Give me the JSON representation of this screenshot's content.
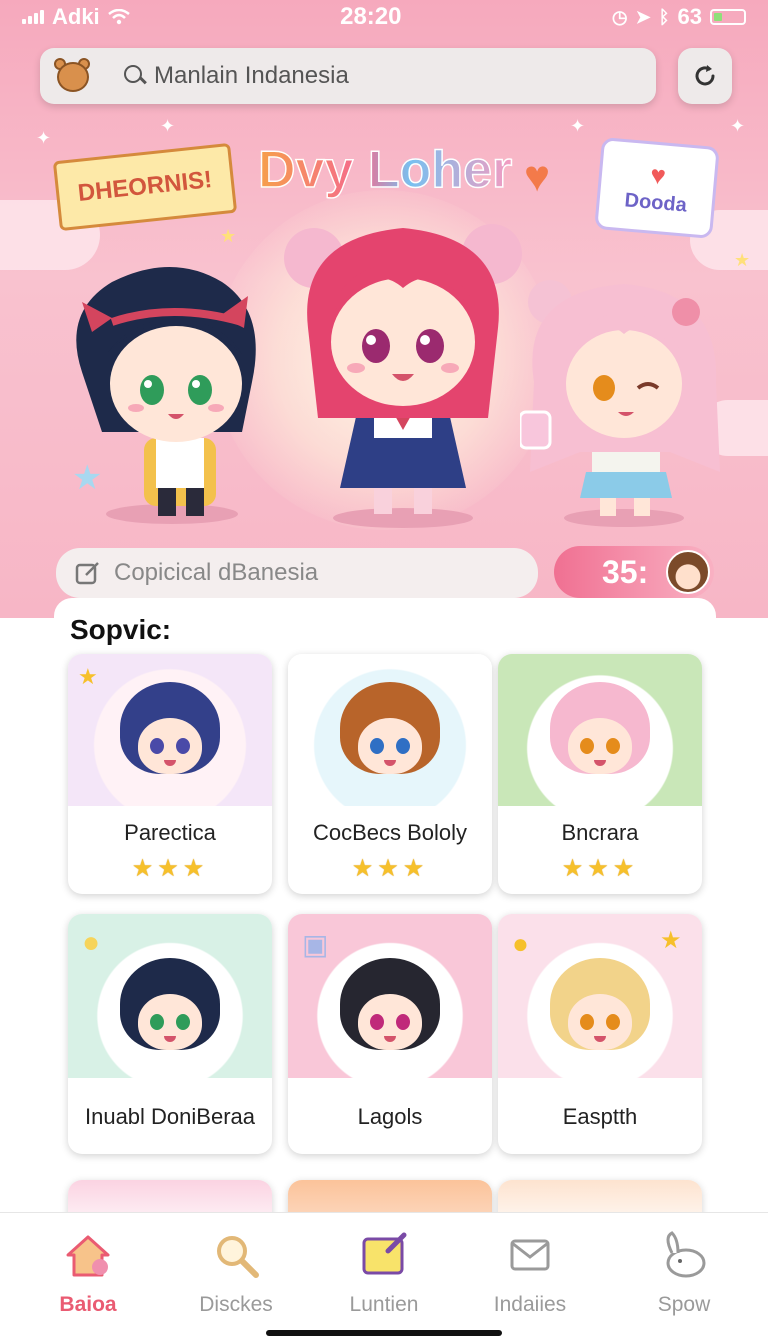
{
  "status_bar": {
    "carrier": "Adki",
    "time": "28:20",
    "battery_level": "63"
  },
  "search": {
    "text": "Manlain Indanesia"
  },
  "hero": {
    "banner_left": "DHEORNIS!",
    "title": "Dvy Loher",
    "bubble_label": "Dooda"
  },
  "compose": {
    "placeholder": "Copicical dBanesia",
    "counter": "35:"
  },
  "section": {
    "title": "Sopvic:"
  },
  "characters": [
    {
      "name": "Parectica",
      "rating": 3
    },
    {
      "name": "CocBecs Bololy",
      "rating": 3
    },
    {
      "name": "Bncrara",
      "rating": 3
    },
    {
      "name": "Inuabl DoniBeraa"
    },
    {
      "name": "Lagols"
    },
    {
      "name": "Easptth"
    }
  ],
  "tabs": [
    {
      "label": "Baioa",
      "icon": "home-icon",
      "active": true
    },
    {
      "label": "Disckes",
      "icon": "magnifier-icon"
    },
    {
      "label": "Luntien",
      "icon": "note-pencil-icon"
    },
    {
      "label": "Indaiies",
      "icon": "envelope-icon"
    },
    {
      "label": "Spow",
      "icon": "bunny-icon"
    }
  ],
  "colors": {
    "accent": "#ea5b72",
    "hero_pink": "#f6a9bd",
    "star": "#f6c02b"
  }
}
